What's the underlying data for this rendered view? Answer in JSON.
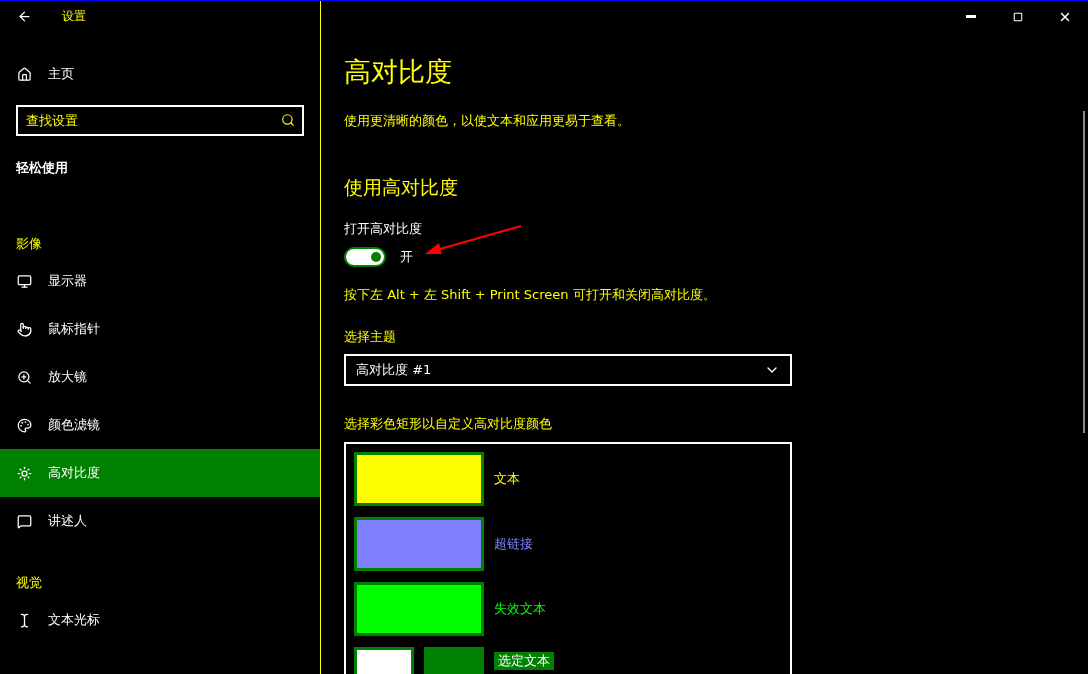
{
  "window": {
    "title": "设置"
  },
  "sidebar": {
    "home": {
      "label": "主页"
    },
    "search": {
      "placeholder": "查找设置"
    },
    "section_title": "轻松使用",
    "groups": [
      {
        "heading": "影像",
        "items": [
          {
            "label": "显示器",
            "selected": false
          },
          {
            "label": "鼠标指针",
            "selected": false
          },
          {
            "label": "放大镜",
            "selected": false
          },
          {
            "label": "颜色滤镜",
            "selected": false
          },
          {
            "label": "高对比度",
            "selected": true
          },
          {
            "label": "讲述人",
            "selected": false
          }
        ]
      },
      {
        "heading": "视觉",
        "items": [
          {
            "label": "文本光标",
            "selected": false
          }
        ]
      }
    ]
  },
  "page": {
    "title": "高对比度",
    "description": "使用更清晰的颜色，以使文本和应用更易于查看。",
    "section_heading": "使用高对比度",
    "toggle": {
      "label": "打开高对比度",
      "on": true,
      "state_label": "开"
    },
    "hint": "按下左 Alt + 左 Shift + Print Screen 可打开和关闭高对比度。",
    "theme": {
      "label": "选择主题",
      "value": "高对比度 #1"
    },
    "colors_label": "选择彩色矩形以自定义高对比度颜色",
    "colors": [
      {
        "kind": "single",
        "label": "文本",
        "color": "#ffff00"
      },
      {
        "kind": "single",
        "label": "超链接",
        "color": "#8080ff"
      },
      {
        "kind": "single",
        "label": "失效文本",
        "color": "#00ff00"
      },
      {
        "kind": "pair",
        "label": "选定文本",
        "swatches": [
          {
            "color": "#ffffff"
          },
          {
            "color": "#008000"
          }
        ]
      }
    ]
  }
}
